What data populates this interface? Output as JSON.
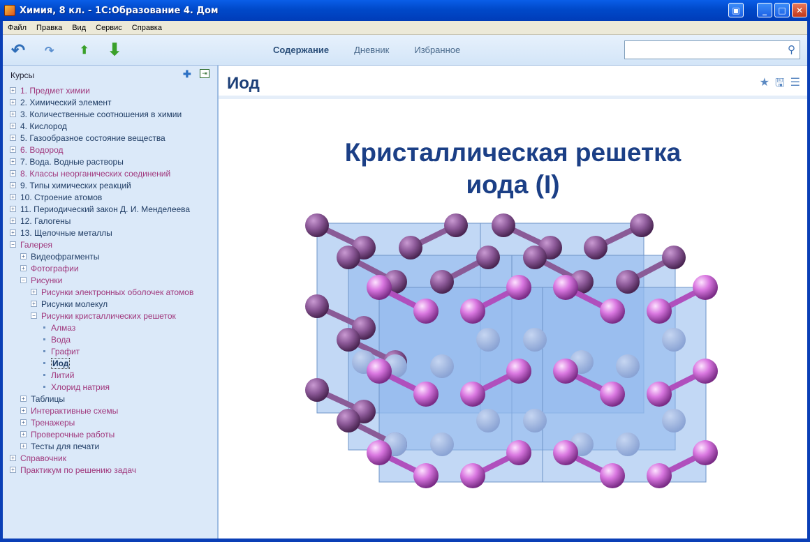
{
  "window": {
    "title": "Химия, 8 кл. - 1С:Образование 4. Дом"
  },
  "menu": [
    "Файл",
    "Правка",
    "Вид",
    "Сервис",
    "Справка"
  ],
  "toolbar": {
    "tabs": [
      "Содержание",
      "Дневник",
      "Избранное"
    ],
    "active_tab": "Содержание",
    "search": {
      "value": "",
      "placeholder": ""
    }
  },
  "sidebar": {
    "header": "Курсы",
    "items": [
      {
        "label": "1. Предмет химии",
        "level": 0,
        "exp": "plus",
        "color": "pink"
      },
      {
        "label": "2. Химический элемент",
        "level": 0,
        "exp": "plus",
        "color": "blue"
      },
      {
        "label": "3. Количественные соотношения в химии",
        "level": 0,
        "exp": "plus",
        "color": "blue"
      },
      {
        "label": "4. Кислород",
        "level": 0,
        "exp": "plus",
        "color": "blue"
      },
      {
        "label": "5. Газообразное состояние вещества",
        "level": 0,
        "exp": "plus",
        "color": "blue"
      },
      {
        "label": "6. Водород",
        "level": 0,
        "exp": "plus",
        "color": "pink"
      },
      {
        "label": "7. Вода. Водные растворы",
        "level": 0,
        "exp": "plus",
        "color": "blue"
      },
      {
        "label": "8. Классы неорганических соединений",
        "level": 0,
        "exp": "plus",
        "color": "pink"
      },
      {
        "label": "9. Типы химических реакций",
        "level": 0,
        "exp": "plus",
        "color": "blue"
      },
      {
        "label": "10. Строение атомов",
        "level": 0,
        "exp": "plus",
        "color": "blue"
      },
      {
        "label": "11. Периодический закон Д. И. Менделеева",
        "level": 0,
        "exp": "plus",
        "color": "blue"
      },
      {
        "label": "12. Галогены",
        "level": 0,
        "exp": "plus",
        "color": "blue"
      },
      {
        "label": "13. Щелочные металлы",
        "level": 0,
        "exp": "plus",
        "color": "blue"
      },
      {
        "label": "Галерея",
        "level": 0,
        "exp": "minus",
        "color": "pink"
      },
      {
        "label": "Видеофрагменты",
        "level": 1,
        "exp": "plus",
        "color": "blue"
      },
      {
        "label": "Фотографии",
        "level": 1,
        "exp": "plus",
        "color": "pink"
      },
      {
        "label": "Рисунки",
        "level": 1,
        "exp": "minus",
        "color": "pink"
      },
      {
        "label": "Рисунки электронных оболочек атомов",
        "level": 2,
        "exp": "plus",
        "color": "pink"
      },
      {
        "label": "Рисунки молекул",
        "level": 2,
        "exp": "plus",
        "color": "blue"
      },
      {
        "label": "Рисунки кристаллических решеток",
        "level": 2,
        "exp": "minus",
        "color": "pink"
      },
      {
        "label": "Алмаз",
        "level": 3,
        "exp": "dot",
        "color": "pink"
      },
      {
        "label": "Вода",
        "level": 3,
        "exp": "dot",
        "color": "pink"
      },
      {
        "label": "Графит",
        "level": 3,
        "exp": "dot",
        "color": "pink"
      },
      {
        "label": "Иод",
        "level": 3,
        "exp": "dot",
        "color": "selected"
      },
      {
        "label": "Литий",
        "level": 3,
        "exp": "dot",
        "color": "pink"
      },
      {
        "label": "Хлорид натрия",
        "level": 3,
        "exp": "dot",
        "color": "pink"
      },
      {
        "label": "Таблицы",
        "level": 1,
        "exp": "plus",
        "color": "blue"
      },
      {
        "label": "Интерактивные схемы",
        "level": 1,
        "exp": "plus",
        "color": "pink"
      },
      {
        "label": "Тренажеры",
        "level": 1,
        "exp": "plus",
        "color": "pink"
      },
      {
        "label": "Проверочные работы",
        "level": 1,
        "exp": "plus",
        "color": "pink"
      },
      {
        "label": "Тесты для печати",
        "level": 1,
        "exp": "plus",
        "color": "blue"
      },
      {
        "label": "Справочник",
        "level": 0,
        "exp": "plus",
        "color": "pink"
      },
      {
        "label": "Практикум по решению задач",
        "level": 0,
        "exp": "plus",
        "color": "pink"
      }
    ]
  },
  "content": {
    "page_title": "Иод",
    "figure_title_line1": "Кристаллическая решетка",
    "figure_title_line2": "иода (I)"
  },
  "colors": {
    "atom_front": "#d977e0",
    "atom_back": "#7a4a86",
    "cube": "#8db6ea",
    "title": "#1b3f86"
  }
}
